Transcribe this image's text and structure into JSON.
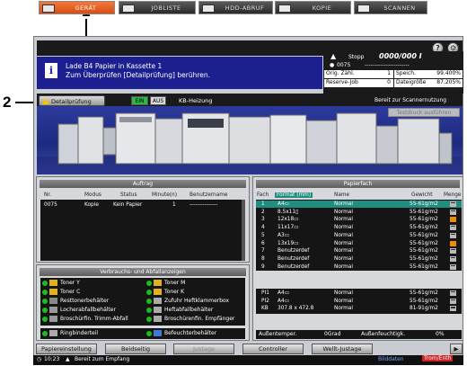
{
  "callouts": {
    "one": "1",
    "two": "2"
  },
  "tabs": [
    {
      "label": "GERÄT",
      "icon": "device-icon",
      "active": true
    },
    {
      "label": "JOBLISTE",
      "icon": "joblist-icon",
      "active": false
    },
    {
      "label": "HDD-ABRUF",
      "icon": "hdd-icon",
      "active": false
    },
    {
      "label": "KOPIE",
      "icon": "copy-icon",
      "active": false
    },
    {
      "label": "SCANNEN",
      "icon": "scan-icon",
      "active": false
    }
  ],
  "top_buttons": {
    "help": "?",
    "wrench": "⚙"
  },
  "message": {
    "line1": "Lade B4 Papier in Kassette 1",
    "line2": "Zum Überprüfen [Detailprüfung] berühren."
  },
  "counters": {
    "stop_label": "Stopp",
    "count_display": "0000/000 I",
    "copies": "0075",
    "dashes": "-----------------------",
    "orig_label": "Orig. Zähl.",
    "orig_value": "1",
    "memory_label": "Speich.",
    "memory_value": "99.400%",
    "reserve_label": "Reserve-Job",
    "reserve_value": "0",
    "hdd_label": "Dateigröße",
    "hdd_value": "87.205%"
  },
  "status": {
    "detail_button": "Detailprüfung",
    "on_label": "EIN",
    "off_label": "AUS",
    "heater_label": "KB-Heizung",
    "scan_ready": "Bereit zur Scannernutzung",
    "test_print": "Testdruck ausführen"
  },
  "jobs": {
    "title": "Auftrag",
    "columns": [
      "Nr.",
      "Modus",
      "Status",
      "Minute(n)",
      "Benutzername"
    ],
    "rows": [
      [
        "0075",
        "Kopie",
        "Kein Papier",
        "1",
        "---------------"
      ]
    ]
  },
  "consumables": {
    "title": "Verbrauchs- und Abfallanzeigen",
    "left": [
      "Toner Y",
      "Toner C",
      "Resttonerbehälter",
      "Locherabfallbehälter",
      "Broschürfin. Trimm-Abfall"
    ],
    "right": [
      "Toner M",
      "Toner K",
      "Zufuhr Heftklammerbox",
      "Heftabfallbehälter",
      "Broschürenfin. Empfänger"
    ],
    "ring_left": "Ringbinderteil",
    "ring_right": "Befeuchterbehälter"
  },
  "paper": {
    "title": "Papierfach",
    "columns": [
      "Fach",
      "Format (mm)",
      "Name",
      "Gewicht",
      "Menge"
    ],
    "rows": [
      [
        "1",
        "A4▭",
        "Normal",
        "55-61g/m2"
      ],
      [
        "2",
        "8.5x11▯",
        "Normal",
        "55-61g/m2"
      ],
      [
        "3",
        "12x18▭",
        "Normal",
        "55-61g/m2"
      ],
      [
        "4",
        "11x17▭",
        "Normal",
        "55-61g/m2"
      ],
      [
        "5",
        "A3▭",
        "Normal",
        "55-61g/m2"
      ],
      [
        "6",
        "13x19▭",
        "Normal",
        "55-61g/m2"
      ],
      [
        "7",
        "Benutzerdef",
        "Normal",
        "55-61g/m2"
      ],
      [
        "8",
        "Benutzerdef",
        "Normal",
        "55-61g/m2"
      ],
      [
        "9",
        "Benutzerdef",
        "Normal",
        "55-61g/m2"
      ]
    ],
    "extra_rows": [
      [
        "PI1",
        "A4▭",
        "Normal",
        "55-61g/m2"
      ],
      [
        "PI2",
        "A4▭",
        "Normal",
        "55-61g/m2"
      ],
      [
        "KB",
        "307.8 x 472.8",
        "Normal",
        "81-91g/m2"
      ]
    ],
    "outside_temp_label": "Außentemper.",
    "outside_temp_value": "0Grad",
    "outside_hum_label": "Außenfeuchtigk.",
    "outside_hum_value": "0%"
  },
  "bottom_buttons": [
    "Papiereinstellung",
    "Beidseitig",
    "Justage",
    "Controller",
    "Wellt-Justage"
  ],
  "footer": {
    "time": "10:23",
    "status": "Bereit zum Empfang",
    "image_data": "Bilddaten",
    "toner_data": "Trom/Enth"
  },
  "colors": {
    "accent_tab": "#e5601f",
    "message_bg": "#1b1f8f",
    "selected_row": "#1f8e80"
  }
}
